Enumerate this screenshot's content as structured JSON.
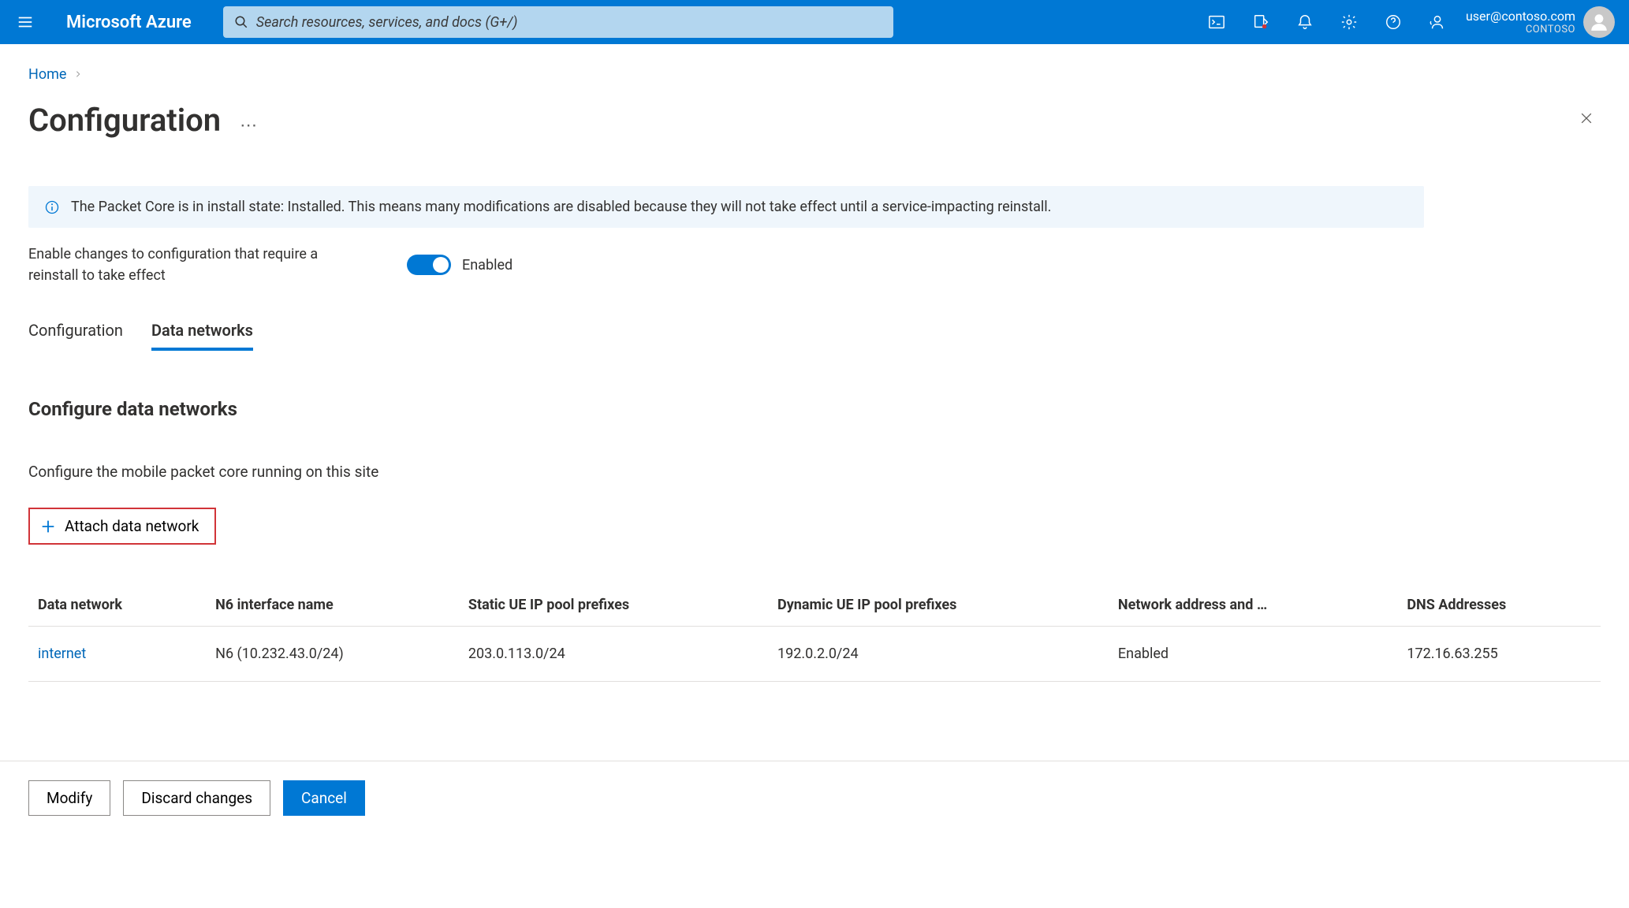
{
  "header": {
    "brand": "Microsoft Azure",
    "search_placeholder": "Search resources, services, and docs (G+/)",
    "user_email": "user@contoso.com",
    "user_tenant": "CONTOSO"
  },
  "breadcrumb": {
    "home": "Home"
  },
  "page": {
    "title": "Configuration"
  },
  "banner": {
    "text": "The Packet Core is in install state: Installed. This means many modifications are disabled because they will not take effect until a service-impacting reinstall."
  },
  "toggle": {
    "label": "Enable changes to configuration that require a reinstall to take effect",
    "state_label": "Enabled"
  },
  "tabs": {
    "items": [
      {
        "label": "Configuration",
        "active": false
      },
      {
        "label": "Data networks",
        "active": true
      }
    ]
  },
  "section": {
    "title": "Configure data networks",
    "subtitle": "Configure the mobile packet core running on this site",
    "attach_label": "Attach data network"
  },
  "table": {
    "columns": [
      "Data network",
      "N6 interface name",
      "Static UE IP pool prefixes",
      "Dynamic UE IP pool prefixes",
      "Network address and …",
      "DNS Addresses"
    ],
    "rows": [
      {
        "name": "internet",
        "n6": "N6 (10.232.43.0/24)",
        "static": "203.0.113.0/24",
        "dynamic": "192.0.2.0/24",
        "nat": "Enabled",
        "dns": "172.16.63.255"
      }
    ]
  },
  "footer": {
    "modify": "Modify",
    "discard": "Discard changes",
    "cancel": "Cancel"
  }
}
